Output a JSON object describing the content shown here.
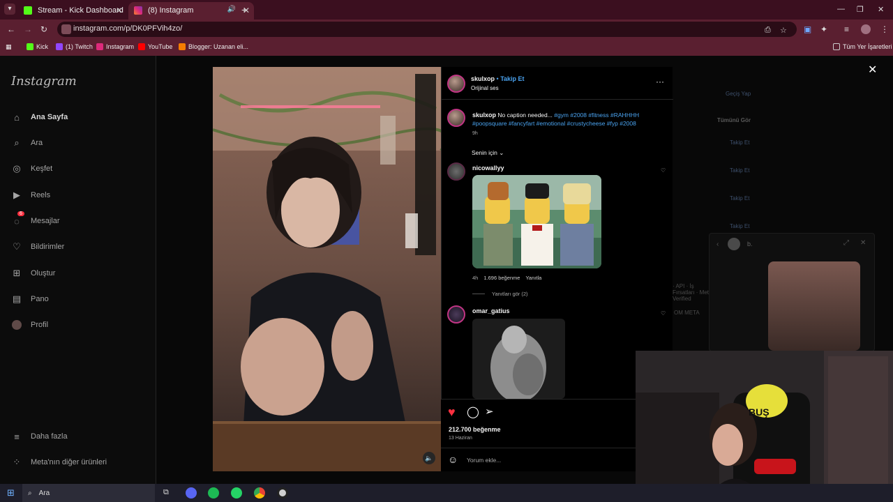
{
  "browser": {
    "tabs": [
      {
        "label": "Stream - Kick Dashboard"
      },
      {
        "label": "(8) Instagram"
      }
    ],
    "url": "instagram.com/p/DK0PFVih4zo/",
    "bookmarks": [
      "Kick",
      "(1) Twitch",
      "Instagram",
      "YouTube",
      "Blogger: Uzanan eli...",
      "Tüm Yer İşaretleri"
    ]
  },
  "sidebar": {
    "logo": "Instagram",
    "items": [
      {
        "label": "Ana Sayfa",
        "icon": "home-icon"
      },
      {
        "label": "Ara",
        "icon": "search-icon"
      },
      {
        "label": "Keşfet",
        "icon": "compass-icon"
      },
      {
        "label": "Reels",
        "icon": "reels-icon"
      },
      {
        "label": "Mesajlar",
        "icon": "messenger-icon",
        "badge": "6"
      },
      {
        "label": "Bildirimler",
        "icon": "heart-icon"
      },
      {
        "label": "Oluştur",
        "icon": "plus-icon"
      },
      {
        "label": "Pano",
        "icon": "chart-icon"
      },
      {
        "label": "Profil",
        "icon": "avatar-icon"
      }
    ],
    "footer": [
      {
        "label": "Daha fazla",
        "icon": "menu-icon"
      },
      {
        "label": "Meta'nın diğer ürünleri",
        "icon": "meta-icon"
      }
    ]
  },
  "background": {
    "switch": "Geçiş Yap",
    "see_all": "Tümünü Gör",
    "follow": "Takip Et",
    "footer": "· API · İş Fırsatları · Meta Verified",
    "meta": "OM META"
  },
  "post": {
    "author": "skulxop",
    "follow": "Takip Et",
    "dot": "•",
    "audio": "Orijinal ses",
    "caption_user": "skulxop",
    "caption_text": "No caption needed...",
    "caption_tags": "#gym #2008 #fitness #RAHHHH #poopsquare #fancyfart #emotional #crustycheese #fyp #2008",
    "caption_time": "9h",
    "filter": "Senin için",
    "comments": [
      {
        "user": "nicowallyy",
        "time": "4h",
        "likes": "1.696 beğenme",
        "reply": "Yanıtla",
        "view_replies": "Yanıtları gör (2)"
      },
      {
        "user": "omar_gatius"
      }
    ],
    "likes": "212.700 beğenme",
    "date": "13 Haziran",
    "comment_placeholder": "Yorum ekle..."
  },
  "dm_preview": {
    "name": "b."
  },
  "webcam": {
    "sign": "BUŞ"
  },
  "taskbar": {
    "search": "Ara"
  },
  "colors": {
    "accent_blue": "#4aa3f0",
    "like_red": "#ff3040",
    "chrome": "#5a1f30"
  }
}
